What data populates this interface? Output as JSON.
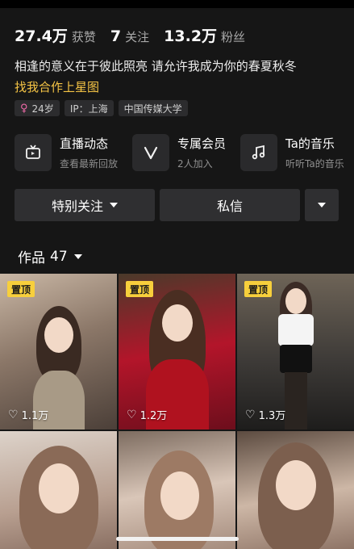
{
  "stats": [
    {
      "num": "27.4万",
      "label": "获赞"
    },
    {
      "num": "7",
      "label": "关注"
    },
    {
      "num": "13.2万",
      "label": "粉丝"
    }
  ],
  "bio": "相逢的意义在于彼此照亮 请允许我成为你的春夏秋冬",
  "bio_link": "找我合作上星图",
  "tags": {
    "age": "24岁",
    "ip": "IP：上海",
    "school": "中国传媒大学"
  },
  "services": [
    {
      "icon": "tv-icon",
      "title": "直播动态",
      "sub": "查看最新回放"
    },
    {
      "icon": "v-badge-icon",
      "title": "专属会员",
      "sub": "2人加入"
    },
    {
      "icon": "music-note-icon",
      "title": "Ta的音乐",
      "sub": "听听Ta的音乐"
    }
  ],
  "buttons": {
    "follow": "特别关注",
    "message": "私信"
  },
  "works": {
    "label": "作品",
    "count": "47"
  },
  "pinned_label": "置顶",
  "videos": [
    {
      "likes": "1.1万",
      "pinned": true
    },
    {
      "likes": "1.2万",
      "pinned": true
    },
    {
      "likes": "1.3万",
      "pinned": true
    },
    {
      "likes": "",
      "pinned": false
    },
    {
      "likes": "",
      "pinned": false
    },
    {
      "likes": "",
      "pinned": false
    }
  ],
  "colors": {
    "background": "#161616",
    "link": "#f5c445",
    "pin_badge": "#f7cf3c",
    "button": "#2f2f31"
  }
}
